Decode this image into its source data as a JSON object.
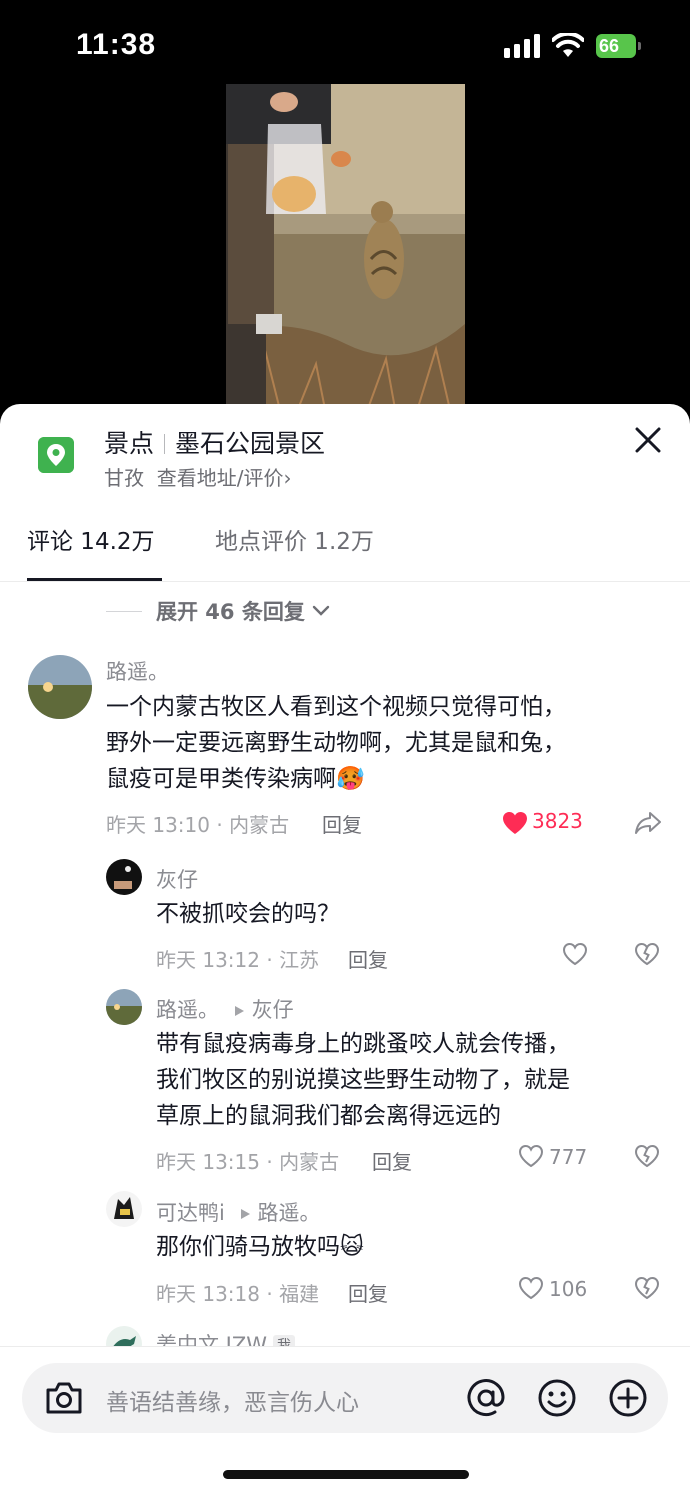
{
  "status": {
    "time": "11:38",
    "battery": "66"
  },
  "location": {
    "category": "景点",
    "name": "墨石公园景区",
    "region": "甘孜",
    "link": "查看地址/评价",
    "chevron": "›"
  },
  "tabs": [
    {
      "label": "评论 14.2万"
    },
    {
      "label": "地点评价 1.2万"
    }
  ],
  "expand": {
    "label": "展开 46 条回复"
  },
  "comments": [
    {
      "user": "路遥。",
      "lines": [
        "一个内蒙古牧区人看到这个视频只觉得可怕，",
        "野外一定要远离野生动物啊，尤其是鼠和兔，",
        "鼠疫可是甲类传染病啊🥵"
      ],
      "time": "昨天 13:10 · 内蒙古",
      "reply": "回复",
      "likes": "3823"
    }
  ],
  "replies": [
    {
      "user": "灰仔",
      "lines": [
        "不被抓咬会的吗？"
      ],
      "time": "昨天 13:12 · 江苏",
      "reply": "回复",
      "likes": ""
    },
    {
      "user": "路遥。",
      "target": "灰仔",
      "lines": [
        "带有鼠疫病毒身上的跳蚤咬人就会传播，",
        "我们牧区的别说摸这些野生动物了，就是",
        "草原上的鼠洞我们都会离得远远的"
      ],
      "time": "昨天 13:15 · 内蒙古",
      "reply": "回复",
      "likes": "777"
    },
    {
      "user": "可达鸭i",
      "target": "路遥。",
      "lines": [
        "那你们骑马放牧吗🙀"
      ],
      "time": "昨天 13:18 · 福建",
      "reply": "回复",
      "likes": "106"
    },
    {
      "user": "姜中文 JZW",
      "tag": "我"
    }
  ],
  "input": {
    "placeholder": "善语结善缘，恶言伤人心"
  },
  "colors": {
    "accent": "#fe2c55",
    "pin": "#3fb24f",
    "battery": "#58c54b"
  }
}
